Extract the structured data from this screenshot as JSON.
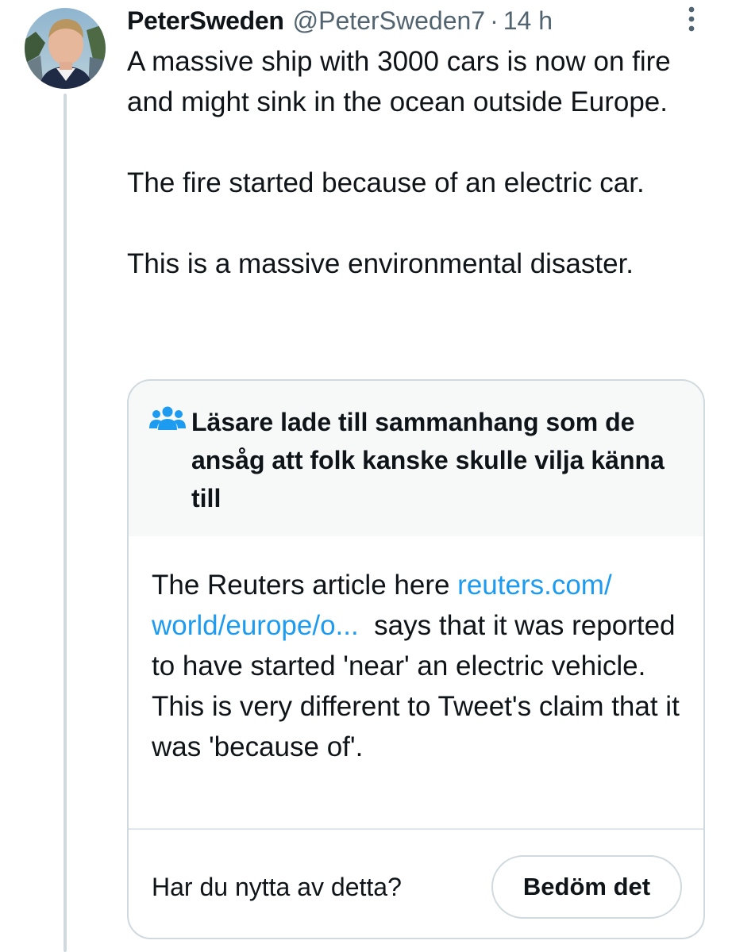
{
  "tweet": {
    "author_name": "PeterSweden",
    "author_handle": "@PeterSweden7",
    "separator": "·",
    "time": "14 h",
    "paragraphs": [
      "A massive ship with 3000 cars is now on fire and might sink in the ocean outside Europe.",
      "The fire started because of an electric car.",
      "This is a massive environmental disaster."
    ]
  },
  "community_note": {
    "icon": "people-group-icon",
    "title": "Läsare lade till sammanhang som de ansåg att folk kanske skulle vilja känna till",
    "text_before_link": "The Reuters article here ",
    "link_text": "reuters.com/ world/europe/o...",
    "text_after_link": "  says that it was reported to have started 'near' an electric vehicle. This is very different to Tweet's claim that it was 'because of'.",
    "helpful_question": "Har du nytta av detta?",
    "rate_button_label": "Bedöm det"
  },
  "colors": {
    "text_primary": "#0f1419",
    "text_secondary": "#536471",
    "link": "#1d9bf0",
    "icon_blue": "#1d9bf0",
    "border": "#cfd9de",
    "note_header_bg": "#f7f9f9"
  }
}
